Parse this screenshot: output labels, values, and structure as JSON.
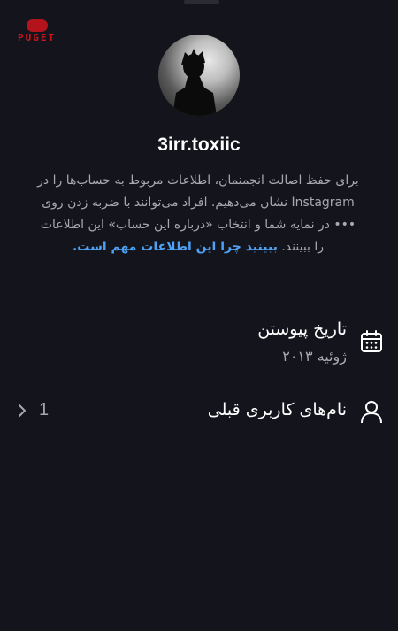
{
  "watermark": {
    "text": "PUGET"
  },
  "profile": {
    "username": "3irr.toxiic"
  },
  "about": {
    "text_before_link": "برای حفظ اصالت انجمنمان، اطلاعات مربوط به حساب‌ها را در Instagram نشان می‌دهیم. افراد می‌توانند با ضربه زدن روی ••• در نمایه شما و انتخاب «درباره این حساب» این اطلاعات را ببینند. ",
    "link_text": "ببینید چرا این اطلاعات مهم است."
  },
  "join_date": {
    "title": "تاریخ پیوستن",
    "value": "ژوئیه ۲۰۱۳",
    "icon": "calendar-icon"
  },
  "former_usernames": {
    "title": "نام‌های کاربری قبلی",
    "count": "1",
    "icon": "person-icon",
    "chevron_icon": "chevron-right-icon"
  },
  "colors": {
    "background": "#14151c",
    "primary_text": "#ffffff",
    "secondary_text": "#a8a8b0",
    "link": "#4ea1f4"
  }
}
